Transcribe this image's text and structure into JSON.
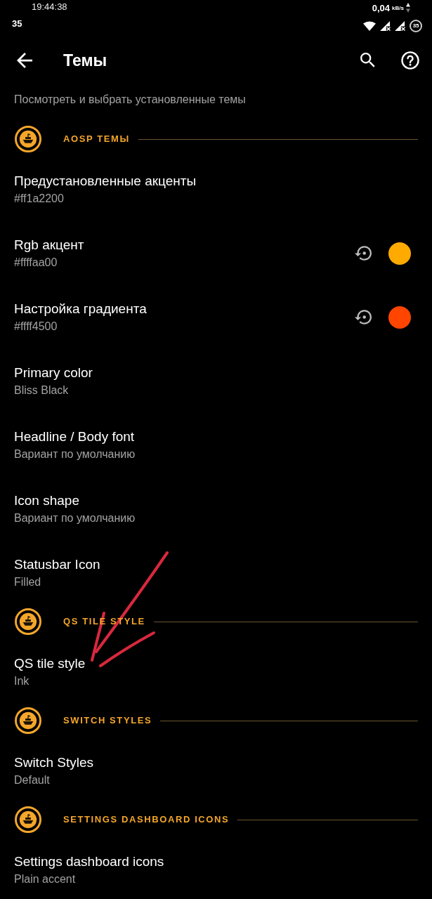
{
  "status_bar": {
    "time": "19:44:38",
    "net_speed": "0,04",
    "net_unit": "kB/s",
    "left_indicator": "35",
    "battery": "35"
  },
  "toolbar": {
    "title": "Темы"
  },
  "list": [
    {
      "kind": "text",
      "subtitle": "Посмотреть и выбрать установленные темы"
    },
    {
      "kind": "section",
      "label": "AOSP ТЕМЫ"
    },
    {
      "kind": "text",
      "title": "Предустановленные акценты",
      "subtitle": "#ff1a2200"
    },
    {
      "kind": "color",
      "title": "Rgb акцент",
      "subtitle": "#ffffaa00",
      "color": "#ffaa00"
    },
    {
      "kind": "color",
      "title": "Настройка градиента",
      "subtitle": "#ffff4500",
      "color": "#ff4500"
    },
    {
      "kind": "text",
      "title": "Primary color",
      "subtitle": "Bliss Black"
    },
    {
      "kind": "text",
      "title": "Headline / Body font",
      "subtitle": "Вариант по умолчанию"
    },
    {
      "kind": "text",
      "title": "Icon shape",
      "subtitle": "Вариант по умолчанию"
    },
    {
      "kind": "text",
      "title": "Statusbar Icon",
      "subtitle": "Filled"
    },
    {
      "kind": "section",
      "label": "QS TILE STYLE"
    },
    {
      "kind": "text",
      "title": "QS tile style",
      "subtitle": "Ink"
    },
    {
      "kind": "section",
      "label": "SWITCH STYLES"
    },
    {
      "kind": "text",
      "title": "Switch Styles",
      "subtitle": "Default"
    },
    {
      "kind": "section",
      "label": "SETTINGS DASHBOARD ICONS"
    },
    {
      "kind": "text",
      "title": "Settings dashboard icons",
      "subtitle": "Plain accent"
    }
  ],
  "annotation": {
    "kind": "arrow"
  }
}
